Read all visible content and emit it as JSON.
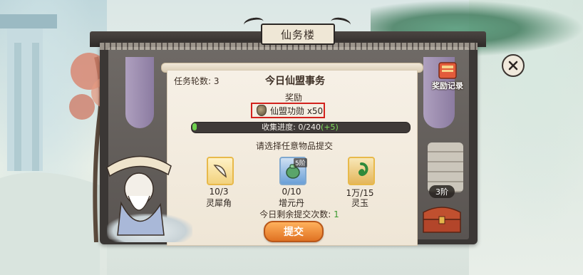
{
  "building_sign": "仙务楼",
  "panel": {
    "round_label": "任务轮数: 3",
    "title": "今日仙盟事务",
    "reward_heading": "奖励",
    "reward_text": "仙盟功勋 x50"
  },
  "progress": {
    "label": "收集进度: 0/240",
    "plus": "(+5)",
    "current": 0,
    "total": 240
  },
  "instruction": "请选择任意物品提交",
  "items": [
    {
      "count": "10/3",
      "name": "灵犀角",
      "badge": ""
    },
    {
      "count": "0/10",
      "name": "增元丹",
      "badge": "5阶"
    },
    {
      "count": "1万/15",
      "name": "灵玉",
      "badge": ""
    }
  ],
  "remaining": {
    "label": "今日剩余提交次数:",
    "value": "1"
  },
  "submit_label": "提交",
  "reward_record_label": "奖励记录",
  "tier_pill": "3阶",
  "colors": {
    "frame": "#3b3735",
    "parchment": "#f6f0e6",
    "progress_fill": "#6fd14d",
    "highlight_box": "#d2221d",
    "submit_button": "#e07223"
  }
}
